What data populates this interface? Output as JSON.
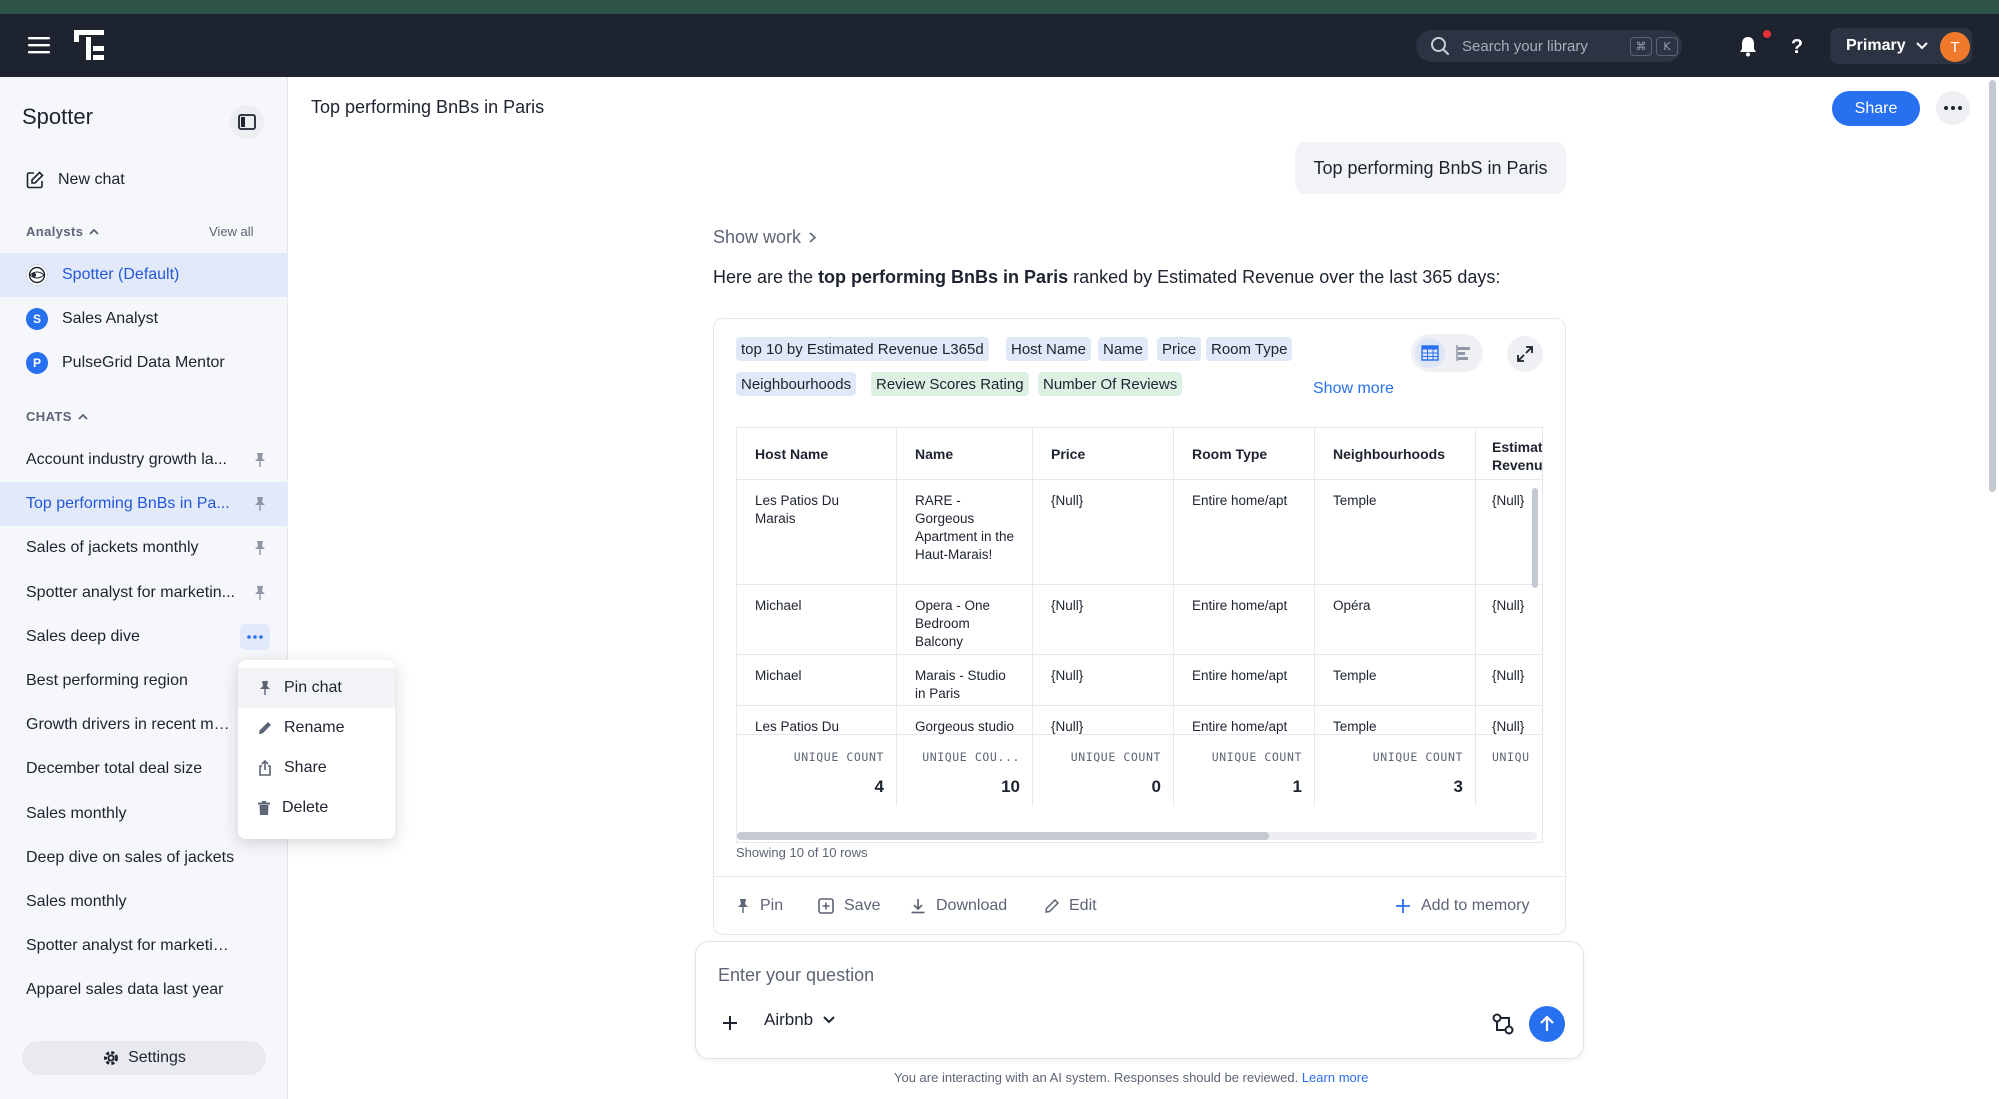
{
  "header": {
    "search_placeholder": "Search your library",
    "shortcut_keys": [
      "⌘",
      "K"
    ],
    "org_label": "Primary",
    "avatar_initial": "T",
    "brand_color": "#1d232f",
    "accent_color": "#2770ef"
  },
  "sidebar": {
    "title": "Spotter",
    "new_chat": "New chat",
    "analysts_header": "Analysts",
    "view_all": "View all",
    "analysts": [
      {
        "label": "Spotter (Default)",
        "icon": "spotter-globe-icon",
        "active": true
      },
      {
        "label": "Sales Analyst",
        "initial": "S",
        "color": "#2770ef"
      },
      {
        "label": "PulseGrid Data Mentor",
        "initial": "P",
        "color": "#2770ef"
      }
    ],
    "chats_header": "CHATS",
    "chats": [
      {
        "label": "Account industry growth la...",
        "pinned": true
      },
      {
        "label": "Top performing BnBs in Pa...",
        "pinned": true,
        "active": true
      },
      {
        "label": "Sales of jackets monthly",
        "pinned": true
      },
      {
        "label": "Spotter analyst for marketin...",
        "pinned": true
      },
      {
        "label": "Sales deep dive",
        "menu_open": true
      },
      {
        "label": "Best performing region"
      },
      {
        "label": "Growth drivers in recent mon..."
      },
      {
        "label": "December total deal size"
      },
      {
        "label": "Sales monthly"
      },
      {
        "label": "Deep dive on sales of jackets"
      },
      {
        "label": "Sales monthly"
      },
      {
        "label": "Spotter analyst for marketing ..."
      },
      {
        "label": "Apparel sales data last year"
      }
    ],
    "settings": "Settings"
  },
  "context_menu": {
    "items": [
      {
        "label": "Pin chat",
        "icon": "pin-icon"
      },
      {
        "label": "Rename",
        "icon": "pencil-icon"
      },
      {
        "label": "Share",
        "icon": "share-icon"
      },
      {
        "label": "Delete",
        "icon": "trash-icon"
      }
    ]
  },
  "main": {
    "page_title": "Top performing BnBs in Paris",
    "share": "Share",
    "user_message": "Top performing BnbS in Paris",
    "show_work": "Show work",
    "intro_prefix": "Here are the ",
    "intro_bold": "top performing BnBs in Paris",
    "intro_suffix": " ranked by Estimated Revenue over the last 365 days:",
    "chips": [
      {
        "label": "top 10 by Estimated Revenue L365d",
        "tone": "blue"
      },
      {
        "label": "Host Name",
        "tone": "blue"
      },
      {
        "label": "Name",
        "tone": "blue"
      },
      {
        "label": "Price",
        "tone": "blue"
      },
      {
        "label": "Room Type",
        "tone": "blue"
      },
      {
        "label": "Neighbourhoods",
        "tone": "blue"
      },
      {
        "label": "Review Scores Rating",
        "tone": "green"
      },
      {
        "label": "Number Of Reviews",
        "tone": "green"
      }
    ],
    "show_more": "Show more",
    "table": {
      "columns": [
        "Host Name",
        "Name",
        "Price",
        "Room Type",
        "Neighbourhoods",
        "Estimat Revenu"
      ],
      "rows": [
        [
          "Les Patios Du Marais",
          "RARE - Gorgeous Apartment in the Haut-Marais!",
          "{Null}",
          "Entire home/apt",
          "Temple",
          "{Null}"
        ],
        [
          "Michael",
          "Opera - One Bedroom Balcony",
          "{Null}",
          "Entire home/apt",
          "Opéra",
          "{Null}"
        ],
        [
          "Michael",
          "Marais - Studio in Paris",
          "{Null}",
          "Entire home/apt",
          "Temple",
          "{Null}"
        ],
        [
          "Les Patios Du Marais",
          "Gorgeous studio in the Haut-Marais",
          "{Null}",
          "Entire home/apt",
          "Temple",
          "{Null}"
        ]
      ],
      "footer_labels": [
        "UNIQUE COUNT",
        "UNIQUE COU...",
        "UNIQUE COUNT",
        "UNIQUE COUNT",
        "UNIQUE COUNT",
        "UNIQU"
      ],
      "footer_values": [
        "4",
        "10",
        "0",
        "1",
        "3",
        ""
      ],
      "rows_info": "Showing 10 of 10 rows"
    },
    "actions": {
      "pin": "Pin",
      "save": "Save",
      "download": "Download",
      "edit": "Edit",
      "add_memory": "Add to memory"
    },
    "composer": {
      "placeholder": "Enter your question",
      "source": "Airbnb"
    },
    "disclaimer": "You are interacting with an AI system. Responses should be reviewed.",
    "learn_more": "Learn more"
  }
}
